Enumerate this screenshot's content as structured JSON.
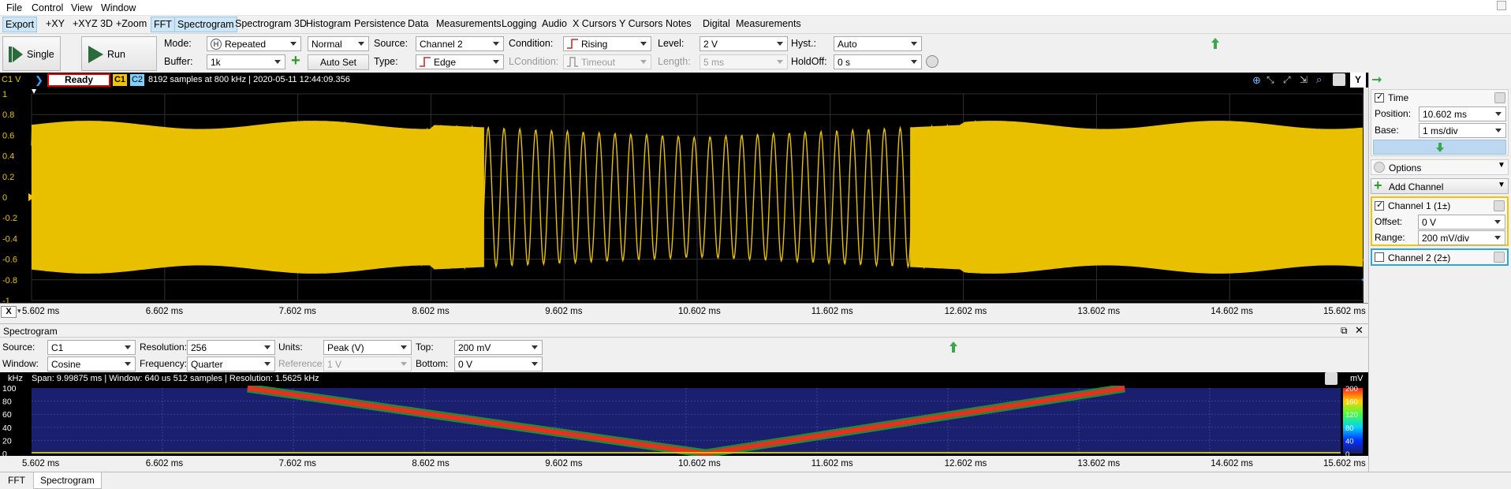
{
  "menu": [
    "File",
    "Control",
    "View",
    "Window"
  ],
  "toolbar": [
    "Export",
    "+XY",
    "+XYZ 3D",
    "+Zoom",
    "FFT",
    "Spectrogram",
    "Spectrogram 3D",
    "Histogram",
    "Persistence",
    "Data",
    "Measurements",
    "Logging",
    "Audio",
    "X Cursors",
    "Y Cursors",
    "Notes",
    "Digital",
    "Measurements"
  ],
  "controls": {
    "single": "Single",
    "run": "Run",
    "mode_label": "Mode:",
    "mode": "Repeated",
    "normal": "Normal",
    "buffer_label": "Buffer:",
    "buffer": "1k",
    "source_label": "Source:",
    "source": "Channel 2",
    "type_label": "Type:",
    "type": "Edge",
    "auto_set": "Auto Set",
    "condition_label": "Condition:",
    "condition": "Rising",
    "lcondition_label": "LCondition:",
    "lcondition": "Timeout",
    "level_label": "Level:",
    "level": "2 V",
    "length_label": "Length:",
    "length": "5 ms",
    "hyst_label": "Hyst.:",
    "hyst": "Auto",
    "holdoff_label": "HoldOff:",
    "holdoff": "0 s"
  },
  "scope": {
    "unit": "C1 V",
    "status": "Ready",
    "c1": "C1",
    "c2": "C2",
    "info": "8192 samples at 800 kHz | 2020-05-11 12:44:09.356",
    "y_label": "Y",
    "y_ticks": [
      "1",
      "0.8",
      "0.6",
      "0.4",
      "0.2",
      "0",
      "-0.2",
      "-0.4",
      "-0.6",
      "-0.8",
      "-1"
    ],
    "x_button": "X",
    "x_ticks": [
      "5.602 ms",
      "6.602 ms",
      "7.602 ms",
      "8.602 ms",
      "9.602 ms",
      "10.602 ms",
      "11.602 ms",
      "12.602 ms",
      "13.602 ms",
      "14.602 ms",
      "15.602 ms"
    ],
    "trace_color": "#e8c000"
  },
  "spectrogram": {
    "title": "Spectrogram",
    "source_label": "Source:",
    "source": "C1",
    "resolution_label": "Resolution:",
    "resolution": "256",
    "units_label": "Units:",
    "units": "Peak (V)",
    "top_label": "Top:",
    "top": "200 mV",
    "window_label": "Window:",
    "window": "Cosine",
    "frequency_label": "Frequency:",
    "frequency": "Quarter",
    "reference_label": "Reference:",
    "reference": "1 V",
    "bottom_label": "Bottom:",
    "bottom": "0 V",
    "khz": "kHz",
    "info": "Span: 9.99875 ms | Window: 640 us 512 samples | Resolution: 1.5625 kHz",
    "mv": "mV",
    "y_ticks": [
      "100",
      "80",
      "60",
      "40",
      "20",
      "0"
    ],
    "scale_ticks": [
      "200",
      "160",
      "120",
      "80",
      "40",
      "0"
    ]
  },
  "bottom_tabs": [
    "FFT",
    "Spectrogram"
  ],
  "panel": {
    "time": "Time",
    "position_label": "Position:",
    "position": "10.602 ms",
    "base_label": "Base:",
    "base": "1 ms/div",
    "options": "Options",
    "add_channel": "Add Channel",
    "ch1": "Channel 1 (1±)",
    "offset_label": "Offset:",
    "offset": "0 V",
    "range_label": "Range:",
    "range": "200 mV/div",
    "ch2": "Channel 2 (2±)",
    "ch1_color": "#f5c400",
    "ch2_color": "#2aa6e0"
  }
}
